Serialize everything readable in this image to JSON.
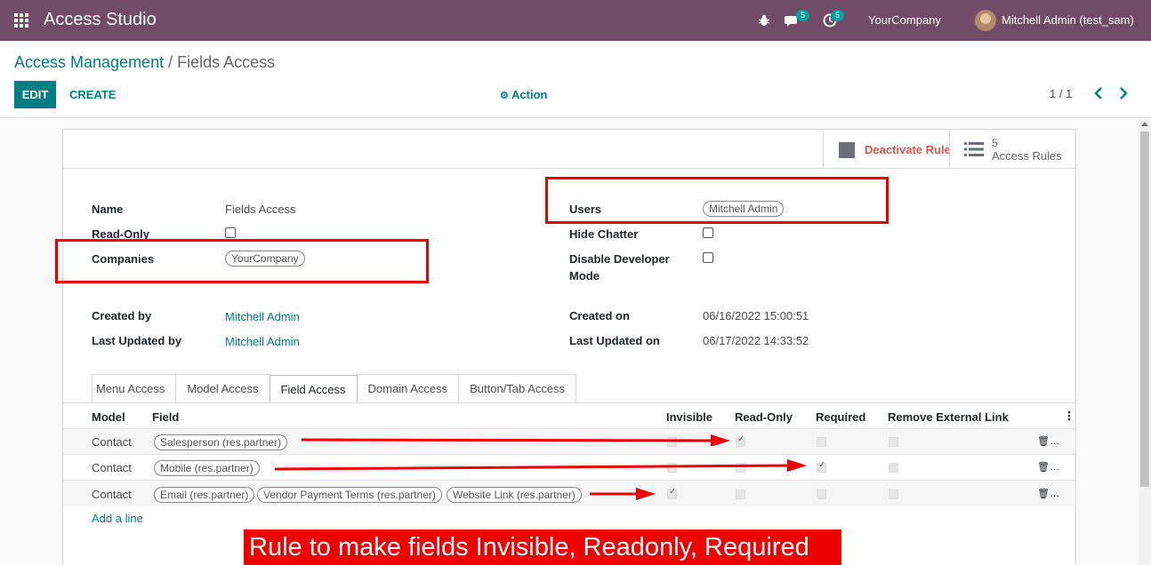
{
  "navbar": {
    "brand": "Access Studio",
    "chat_badge": "5",
    "activity_badge": "5",
    "company": "YourCompany",
    "user": "Mitchell Admin (test_sam)",
    "bg_color": "#714b67"
  },
  "breadcrumb": {
    "parent": "Access Management",
    "separator": "/",
    "current": "Fields Access"
  },
  "toolbar": {
    "edit_label": "EDIT",
    "create_label": "CREATE",
    "action_label": "Action",
    "pager": "1 / 1"
  },
  "smart_buttons": {
    "deactivate_label": "Deactivate Rule",
    "rules_count": "5",
    "rules_label": "Access Rules"
  },
  "form": {
    "name_label": "Name",
    "name_value": "Fields Access",
    "readonly_label": "Read-Only",
    "companies_label": "Companies",
    "companies_tag": "YourCompany",
    "users_label": "Users",
    "users_tag": "Mitchell Admin",
    "hide_chatter_label": "Hide Chatter",
    "disable_dev_label_1": "Disable Developer",
    "disable_dev_label_2": "Mode",
    "created_by_label": "Created by",
    "created_by_value": "Mitchell Admin",
    "last_updated_by_label": "Last Updated by",
    "last_updated_by_value": "Mitchell Admin",
    "created_on_label": "Created on",
    "created_on_value": "06/16/2022 15:00:51",
    "last_updated_on_label": "Last Updated on",
    "last_updated_on_value": "06/17/2022 14:33:52"
  },
  "tabs": [
    {
      "label": "Menu Access"
    },
    {
      "label": "Model Access"
    },
    {
      "label": "Field Access"
    },
    {
      "label": "Domain Access"
    },
    {
      "label": "Button/Tab Access"
    }
  ],
  "active_tab": "Field Access",
  "table": {
    "headers": {
      "model": "Model",
      "field": "Field",
      "invisible": "Invisible",
      "readonly": "Read-Only",
      "required": "Required",
      "remove_link": "Remove External Link"
    },
    "rows": [
      {
        "model": "Contact",
        "fields": [
          "Salesperson (res.partner)"
        ],
        "invisible": false,
        "readonly": true,
        "required": false,
        "remove_link": false
      },
      {
        "model": "Contact",
        "fields": [
          "Mobile (res.partner)"
        ],
        "invisible": false,
        "readonly": false,
        "required": true,
        "remove_link": false
      },
      {
        "model": "Contact",
        "fields": [
          "Email (res.partner)",
          "Vendor Payment Terms (res.partner)",
          "Website Link (res.partner)"
        ],
        "invisible": true,
        "readonly": false,
        "required": false,
        "remove_link": false
      }
    ],
    "add_line": "Add a line"
  },
  "banner": "Rule to make fields Invisible, Readonly, Required"
}
